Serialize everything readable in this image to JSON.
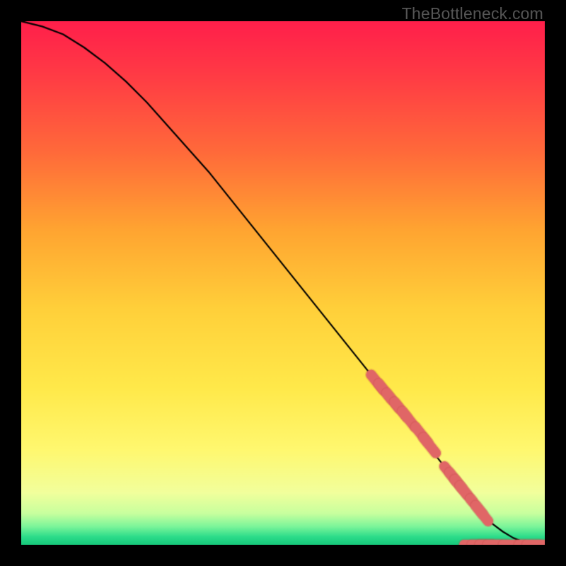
{
  "watermark": "TheBottleneck.com",
  "colors": {
    "frame": "#000000",
    "marker_fill": "#e06666",
    "marker_stroke": "#c94d4d",
    "curve": "#000000",
    "gradient_stops": [
      {
        "offset": 0.0,
        "color": "#ff1f4b"
      },
      {
        "offset": 0.1,
        "color": "#ff3a45"
      },
      {
        "offset": 0.25,
        "color": "#ff6a3a"
      },
      {
        "offset": 0.4,
        "color": "#ffa531"
      },
      {
        "offset": 0.55,
        "color": "#ffd03a"
      },
      {
        "offset": 0.7,
        "color": "#ffe94a"
      },
      {
        "offset": 0.82,
        "color": "#fff870"
      },
      {
        "offset": 0.9,
        "color": "#f2ff9c"
      },
      {
        "offset": 0.94,
        "color": "#c8ff9e"
      },
      {
        "offset": 0.965,
        "color": "#7cf59a"
      },
      {
        "offset": 0.985,
        "color": "#2bdc8a"
      },
      {
        "offset": 1.0,
        "color": "#17c87b"
      }
    ]
  },
  "chart_data": {
    "type": "line",
    "title": "",
    "xlabel": "",
    "ylabel": "",
    "xlim": [
      0,
      100
    ],
    "ylim": [
      0,
      100
    ],
    "series": [
      {
        "name": "bottleneck-curve",
        "x": [
          0,
          4,
          8,
          12,
          16,
          20,
          24,
          28,
          32,
          36,
          40,
          44,
          48,
          52,
          56,
          60,
          64,
          68,
          72,
          76,
          80,
          82,
          84,
          86,
          88,
          90,
          92,
          94,
          96,
          98,
          100
        ],
        "y": [
          100,
          99,
          97.5,
          95,
          92,
          88.5,
          84.5,
          80,
          75.5,
          71,
          66,
          61,
          56,
          51,
          46,
          41,
          36,
          31,
          26,
          21,
          16,
          13.5,
          11,
          8.5,
          6,
          4,
          2.5,
          1.3,
          0.5,
          0.1,
          0
        ]
      }
    ],
    "markers": [
      {
        "name": "curve-marker",
        "x": 68,
        "y": 31
      },
      {
        "name": "curve-marker",
        "x": 69.5,
        "y": 29.3
      },
      {
        "name": "curve-marker",
        "x": 71,
        "y": 27.5
      },
      {
        "name": "curve-marker",
        "x": 72.5,
        "y": 25.8
      },
      {
        "name": "curve-marker",
        "x": 74,
        "y": 24
      },
      {
        "name": "curve-marker",
        "x": 76.5,
        "y": 21
      },
      {
        "name": "curve-marker",
        "x": 78,
        "y": 19
      },
      {
        "name": "curve-marker",
        "x": 82,
        "y": 13.5
      },
      {
        "name": "curve-marker",
        "x": 83,
        "y": 12.3
      },
      {
        "name": "curve-marker",
        "x": 84,
        "y": 11
      },
      {
        "name": "curve-marker",
        "x": 85,
        "y": 9.8
      },
      {
        "name": "curve-marker",
        "x": 87,
        "y": 7.3
      },
      {
        "name": "curve-marker",
        "x": 88,
        "y": 6
      },
      {
        "name": "baseline-marker",
        "x": 86.5,
        "y": 0
      },
      {
        "name": "baseline-marker",
        "x": 88,
        "y": 0
      },
      {
        "name": "baseline-marker",
        "x": 89.5,
        "y": 0
      },
      {
        "name": "baseline-marker",
        "x": 91,
        "y": 0
      },
      {
        "name": "baseline-marker",
        "x": 94,
        "y": 0
      },
      {
        "name": "baseline-marker",
        "x": 97,
        "y": 0
      },
      {
        "name": "baseline-marker",
        "x": 98.5,
        "y": 0
      }
    ]
  }
}
